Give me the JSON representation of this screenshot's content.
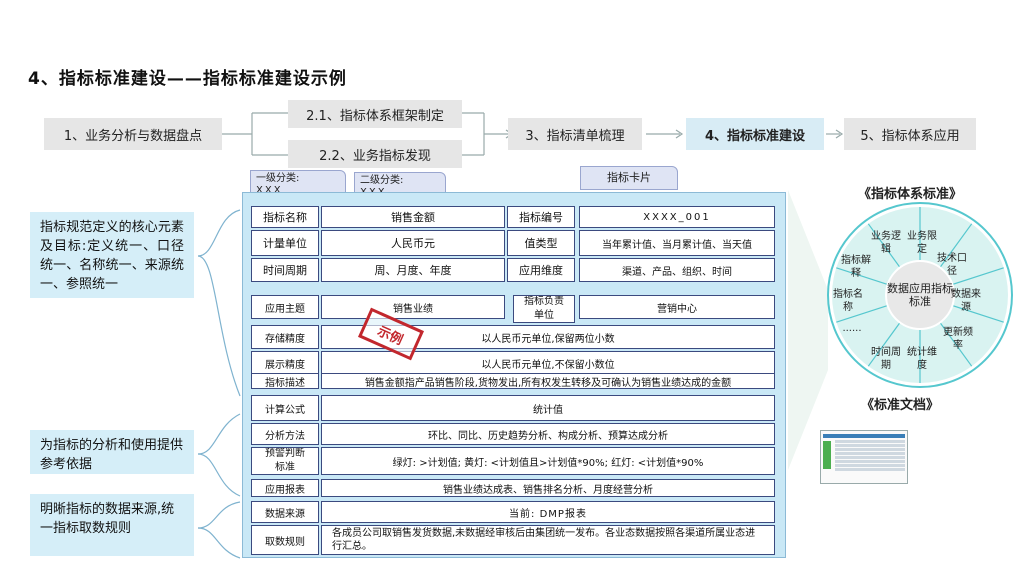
{
  "page_title": "4、指标标准建设——指标标准建设示例",
  "flow": {
    "step1": "1、业务分析与数据盘点",
    "step2a": "2.1、指标体系框架制定",
    "step2b": "2.2、业务指标发现",
    "step3": "3、指标清单梳理",
    "step4": "4、指标标准建设",
    "step5": "5、指标体系应用"
  },
  "tabs": {
    "level1_label": "一级分类:",
    "level1_value": "XXX",
    "level2_label": "二级分类:",
    "level2_value": "XXX",
    "card_label": "指标卡片"
  },
  "card": {
    "name_label": "指标名称",
    "name_value": "销售金额",
    "code_label": "指标编号",
    "code_value": "XXXX_001",
    "unit_label": "计量单位",
    "unit_value": "人民币元",
    "valtype_label": "值类型",
    "valtype_value": "当年累计值、当月累计值、当天值",
    "period_label": "时间周期",
    "period_value": "周、月度、年度",
    "dim_label": "应用维度",
    "dim_value": "渠道、产品、组织、时间",
    "theme_label": "应用主题",
    "theme_value": "销售业绩",
    "owner_label": "指标负责单位",
    "owner_value": "营销中心",
    "storage_label": "存储精度",
    "storage_value": "以人民币元单位,保留两位小数",
    "display_label": "展示精度",
    "display_value": "以人民币元单位,不保留小数位",
    "desc_label": "指标描述",
    "desc_value": "销售金额指产品销售阶段,货物发出,所有权发生转移及可确认为销售业绩达成的金额",
    "formula_label": "计算公式",
    "formula_value": "统计值",
    "method_label": "分析方法",
    "method_value": "环比、同比、历史趋势分析、构成分析、预算达成分析",
    "warn_label": "预警判断标准",
    "warn_value": "绿灯: >计划值; 黄灯: <计划值且>计划值*90%; 红灯: <计划值*90%",
    "report_label": "应用报表",
    "report_value": "销售业绩达成表、销售排名分析、月度经营分析",
    "source_label": "数据来源",
    "source_value": "当前: DMP报表",
    "rule_label": "取数规则",
    "rule_value": "各成员公司取销售发货数据,未数据经审核后由集团统一发布。各业态数据按照各渠道所属业态进行汇总。"
  },
  "stamp": "示例",
  "notes": {
    "note1": "指标规范定义的核心元素及目标:定义统一、口径统一、名称统一、来源统一、参照统一",
    "note2": "为指标的分析和使用提供参考依据",
    "note3": "明晰指标的数据来源,统一指标取数规则"
  },
  "right": {
    "standard_title": "《指标体系标准》",
    "doc_title": "《标准文档》",
    "center": "数据应用指标标准",
    "segments": [
      "业务限定",
      "技术口径",
      "数据来源",
      "更新频率",
      "统计维度",
      "时间周期",
      "......",
      "指标名称",
      "指标解释",
      "业务逻辑"
    ]
  },
  "colors": {
    "card_bg": "#c9e8f6",
    "cell_border": "#3b4a7f",
    "ring": "#55c7ce",
    "note_bg": "#d5eef8",
    "stamp": "#c2272d"
  }
}
